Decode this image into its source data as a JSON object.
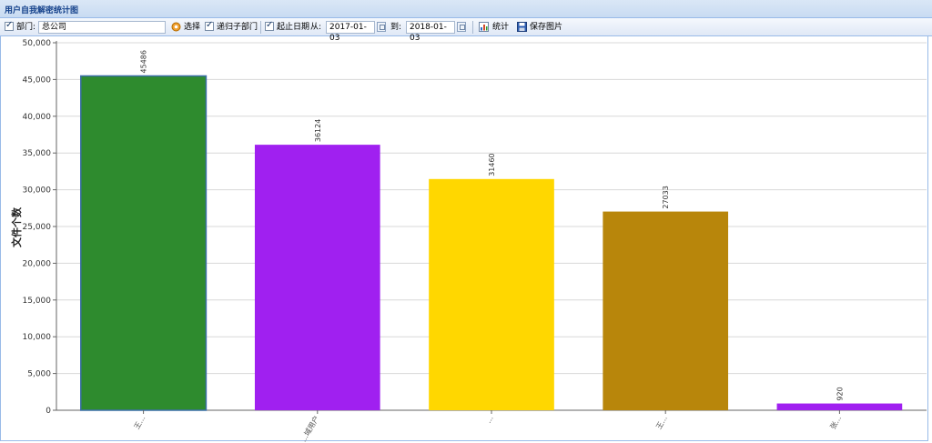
{
  "window": {
    "title": "用户自我解密统计图"
  },
  "toolbar": {
    "dept_label": "部门:",
    "dept_value": "总公司",
    "select_label": "选择",
    "recursive_label": "递归子部门",
    "date_range_label": "起止日期",
    "from_label": "从:",
    "from_value": "2017-01-03",
    "to_label": "到:",
    "to_value": "2018-01-03",
    "stats_label": "统计",
    "save_label": "保存图片"
  },
  "chart_data": {
    "type": "bar",
    "ylabel": "文件个数",
    "ylim": [
      0,
      50000
    ],
    "yticks": [
      "0",
      "5,000",
      "10,000",
      "15,000",
      "20,000",
      "25,000",
      "30,000",
      "35,000",
      "40,000",
      "45,000",
      "50,000"
    ],
    "categories": [
      "王...",
      "...域用户",
      "...",
      "王...",
      "张..."
    ],
    "values": [
      45486,
      36124,
      31460,
      27033,
      920
    ],
    "data_labels": [
      "45486",
      "36124",
      "31460",
      "27033",
      "920"
    ],
    "colors": [
      "#2e8b2e",
      "#a020f0",
      "#ffd700",
      "#b8860b",
      "#a020f0"
    ],
    "grid": true
  }
}
